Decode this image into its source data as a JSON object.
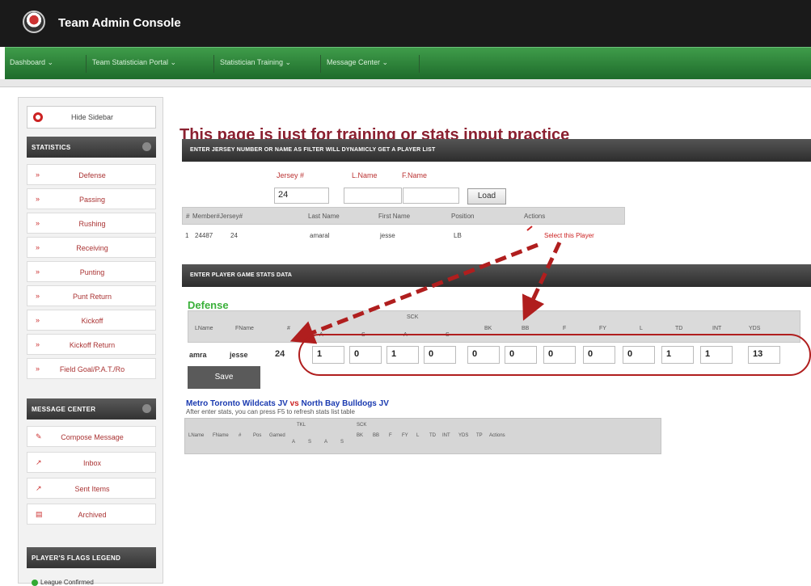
{
  "app": {
    "title": "Team Admin Console"
  },
  "nav": [
    "Dashboard ⌄",
    "Team Statistician Portal ⌄",
    "Statistician Training ⌄",
    "Message Center ⌄"
  ],
  "sidebar": {
    "hide_label": "Hide Sidebar",
    "statistics_title": "STATISTICS",
    "stats_items": [
      "Defense",
      "Passing",
      "Rushing",
      "Receiving",
      "Punting",
      "Punt Return",
      "Kickoff",
      "Kickoff Return",
      "Field Goal/P.A.T./Ro"
    ],
    "message_title": "MESSAGE CENTER",
    "message_items": [
      "Compose Message",
      "Inbox",
      "Sent Items",
      "Archived"
    ],
    "legend_title": "PLAYER'S FLAGS LEGEND",
    "legend_item": "League Confirmed"
  },
  "main": {
    "page_title": "This page is just for training or stats input practice",
    "filter_panel_title": "ENTER JERSEY NUMBER OR NAME AS FILTER WILL DYNAMICLY GET A PLAYER LIST",
    "jersey_label": "Jersey #",
    "lname_label": "L.Name",
    "fname_label": "F.Name",
    "jersey_value": "24",
    "lname_value": "",
    "fname_value": "",
    "load_label": "Load",
    "player_table": {
      "headers": [
        "#",
        "Member#",
        "Jersey#",
        "Last Name",
        "First Name",
        "Position",
        "Actions"
      ],
      "row": [
        "1",
        "24487",
        "24",
        "amaral",
        "jesse",
        "LB"
      ],
      "action": "Select this Player"
    },
    "stats_panel_title": "ENTER PLAYER GAME STATS DATA",
    "defense_title": "Defense",
    "defense_group_label": "SCK",
    "defense_headers": [
      "LName",
      "FName",
      "#",
      "A",
      "S",
      "A",
      "S",
      "BK",
      "BB",
      "F",
      "FY",
      "L",
      "TD",
      "INT",
      "YDS"
    ],
    "defense_row": {
      "lname": "amra",
      "fname": "jesse",
      "number": "24"
    },
    "defense_values": [
      "1",
      "0",
      "1",
      "0",
      "0",
      "0",
      "0",
      "0",
      "0",
      "1",
      "1",
      "13"
    ],
    "save_label": "Save",
    "game": {
      "team_a": "Metro Toronto Wildcats JV",
      "vs": "vs",
      "team_b": "North Bay Bulldogs JV",
      "note": "After enter stats, you can press F5 to refresh stats list table",
      "group_tkl": "TKL",
      "group_sck": "SCK",
      "headers": [
        "LName",
        "FName",
        "#",
        "Pos",
        "Gamed",
        "A",
        "S",
        "A",
        "S",
        "BK",
        "BB",
        "F",
        "FY",
        "L",
        "TD",
        "INT",
        "YDS",
        "TP",
        "Actions"
      ]
    }
  },
  "colors": {
    "title": "#8b2030",
    "nav": "#2e7d3a",
    "defense": "#3ab03a",
    "arrow": "#b01e1e"
  }
}
